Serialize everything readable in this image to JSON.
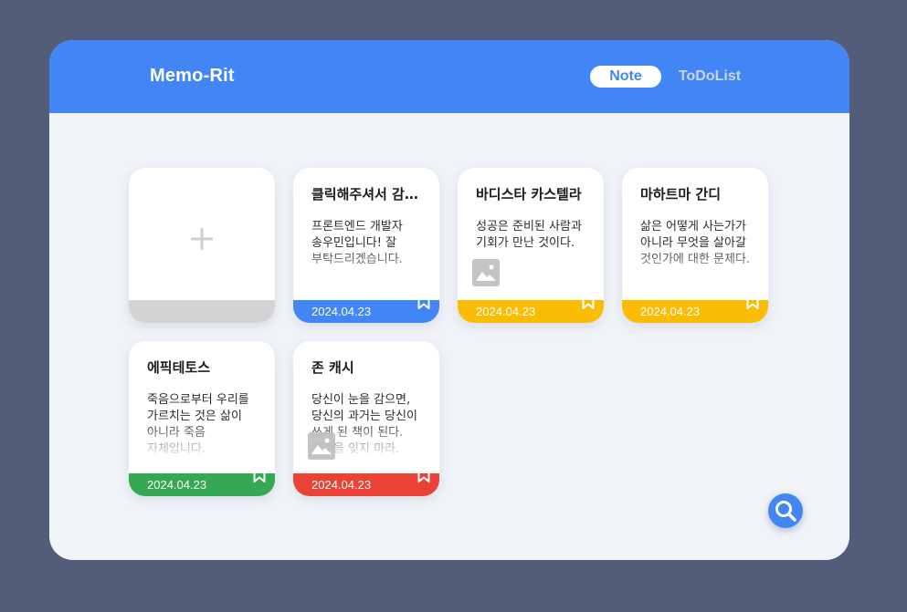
{
  "app": {
    "title": "Memo-Rit"
  },
  "nav": {
    "tabs": [
      {
        "label": "Note",
        "active": true
      },
      {
        "label": "ToDoList",
        "active": false
      }
    ]
  },
  "add_card": {
    "icon": "plus-icon",
    "symbol": "+"
  },
  "notes": [
    {
      "title": "클릭해주셔서 감사합니다",
      "body": "프론트엔드 개발자 송우민입니다! 잘 부탁드리겠습니다.",
      "date": "2024.04.23",
      "color": "#4285f4",
      "has_image": false
    },
    {
      "title": "바디스타 카스텔라",
      "body": "성공은 준비된 사람과 기회가 만난 것이다.",
      "date": "2024.04.23",
      "color": "#fbbc05",
      "has_image": true
    },
    {
      "title": "마하트마 간디",
      "body": "삶은 어떻게 사는가가 아니라 무엇을 살아갈 것인가에 대한 문제다.",
      "date": "2024.04.23",
      "color": "#fbbc05",
      "has_image": false
    },
    {
      "title": "에픽테토스",
      "body": "죽음으로부터 우리를 가르치는 것은 삶이 아니라 죽음 자체입니다.",
      "date": "2024.04.23",
      "color": "#34a853",
      "has_image": false
    },
    {
      "title": "존 캐시",
      "body": "당신이 눈을 감으면, 당신의 과거는 당신이 쓰게 된 책이 된다. 그것을 잊지 마라.",
      "date": "2024.04.23",
      "color": "#ea4335",
      "has_image": true
    }
  ],
  "icons": {
    "bookmark": "bookmark-icon",
    "image": "image-icon",
    "search": "search-icon"
  },
  "colors": {
    "background": "#535c79",
    "header": "#4285f4",
    "panel": "#f0f3f8",
    "add_card_footer": "#d4d4d6"
  }
}
